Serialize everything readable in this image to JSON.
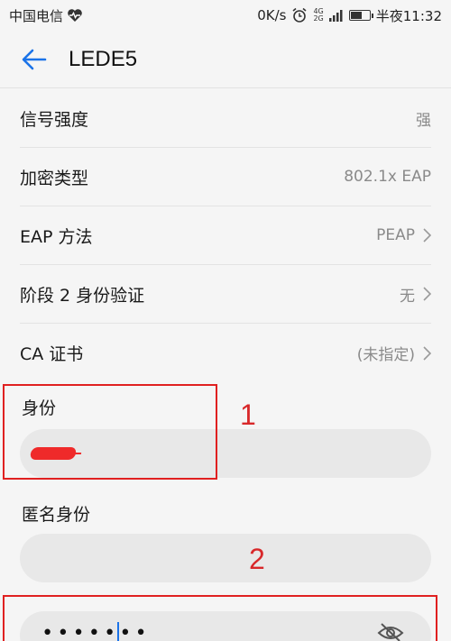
{
  "status_bar": {
    "carrier": "中国电信",
    "speed": "0K/s",
    "net_tag_top": "4G",
    "net_tag_bottom": "2G",
    "time": "半夜11:32"
  },
  "header": {
    "title": "LEDE5"
  },
  "rows": [
    {
      "label": "信号强度",
      "value": "强",
      "chevron": false
    },
    {
      "label": "加密类型",
      "value": "802.1x EAP",
      "chevron": false
    },
    {
      "label": "EAP 方法",
      "value": "PEAP",
      "chevron": true
    },
    {
      "label": "阶段 2 身份验证",
      "value": "无",
      "chevron": true
    },
    {
      "label": "CA 证书",
      "value": "(未指定)",
      "chevron": true
    }
  ],
  "identity": {
    "label": "身份"
  },
  "anonymous_identity": {
    "label": "匿名身份"
  },
  "password": {
    "masked_value": "•••••••"
  },
  "annotations": {
    "num1": "1",
    "num2": "2"
  },
  "colors": {
    "accent": "#1b73e8",
    "annotation": "#e02020"
  }
}
